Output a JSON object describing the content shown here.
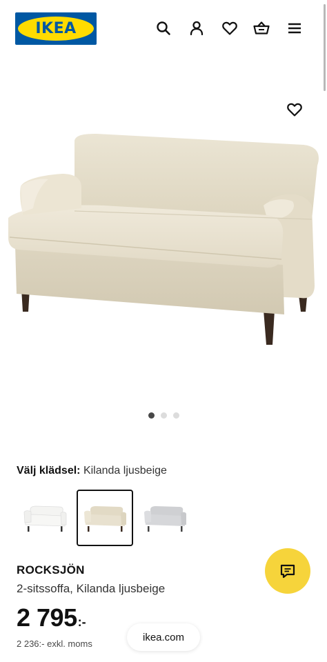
{
  "header": {
    "logo_text": "IKEA",
    "icons": [
      "search-icon",
      "user-icon",
      "heart-icon",
      "basket-icon",
      "menu-icon"
    ]
  },
  "product": {
    "favorite_icon": "heart-icon",
    "gallery": {
      "total_images": 3,
      "active_index": 0
    },
    "upholstery_label": "Välj klädsel:",
    "upholstery_value": "Kilanda ljusbeige",
    "swatches": [
      {
        "name": "white",
        "color": "#f4f4f2",
        "selected": false
      },
      {
        "name": "kilanda-ljusbeige",
        "color": "#e6dfcb",
        "selected": true
      },
      {
        "name": "grey",
        "color": "#d2d3d6",
        "selected": false
      }
    ],
    "name": "ROCKSJÖN",
    "description": "2-sitssoffa, Kilanda ljusbeige",
    "price": "2 795",
    "price_suffix": ":-",
    "price_excl_vat": "2 236:- exkl. moms"
  },
  "chat": {
    "icon": "chat-icon"
  },
  "browser": {
    "url": "ikea.com"
  },
  "colors": {
    "brand_blue": "#0058a3",
    "brand_yellow": "#ffdb00",
    "chat_yellow": "#f6d43b",
    "sofa_fabric": "#e8e1cf",
    "sofa_legs": "#3a2a20"
  }
}
